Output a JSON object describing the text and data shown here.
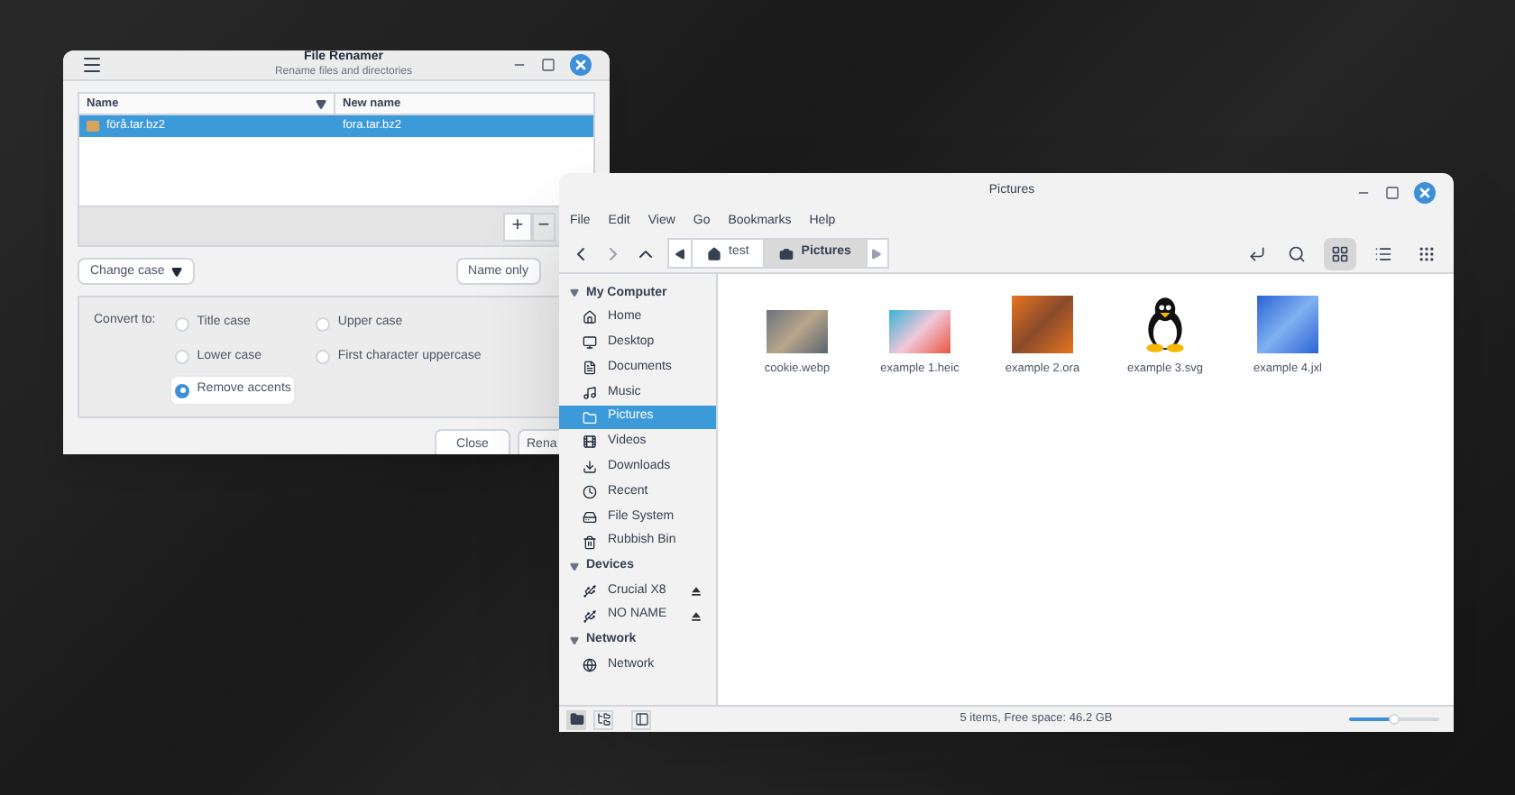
{
  "renamer": {
    "title": "File Renamer",
    "subtitle": "Rename files and directories",
    "table": {
      "columns": [
        {
          "label": "Name",
          "sorted": true
        },
        {
          "label": "New name",
          "sorted": false
        }
      ],
      "rows": [
        {
          "name": "förå.tar.bz2",
          "new_name": "fora.tar.bz2",
          "selected": true
        }
      ]
    },
    "add_button": "+",
    "remove_button": "−",
    "mode_dropdown": "Change case",
    "scope_dropdown": "Name only",
    "convert_label": "Convert to:",
    "options": [
      {
        "label": "Title case",
        "selected": false
      },
      {
        "label": "Upper case",
        "selected": false
      },
      {
        "label": "Lower case",
        "selected": false
      },
      {
        "label": "First character uppercase",
        "selected": false
      },
      {
        "label": "Remove accents",
        "selected": true
      }
    ],
    "buttons": [
      "Close",
      "Rena"
    ]
  },
  "files": {
    "title": "Pictures",
    "menu": [
      "File",
      "Edit",
      "View",
      "Go",
      "Bookmarks",
      "Help"
    ],
    "breadcrumbs": [
      {
        "label": "test",
        "selected": false
      },
      {
        "label": "Pictures",
        "selected": true
      }
    ],
    "views": [
      {
        "selected": true
      },
      {
        "selected": false
      },
      {
        "selected": false
      }
    ],
    "sidebar": [
      {
        "label": "My Computer",
        "expanded": true,
        "items": [
          {
            "label": "Home",
            "selected": false
          },
          {
            "label": "Desktop",
            "selected": false
          },
          {
            "label": "Documents",
            "selected": false
          },
          {
            "label": "Music",
            "selected": false
          },
          {
            "label": "Pictures",
            "selected": true
          },
          {
            "label": "Videos",
            "selected": false
          },
          {
            "label": "Downloads",
            "selected": false
          },
          {
            "label": "Recent",
            "selected": false
          },
          {
            "label": "File System",
            "selected": false
          },
          {
            "label": "Rubbish Bin",
            "selected": false
          }
        ]
      },
      {
        "label": "Devices",
        "expanded": true,
        "items": [
          {
            "label": "Crucial X8",
            "selected": false,
            "ejectable": true
          },
          {
            "label": "NO NAME",
            "selected": false,
            "ejectable": true
          }
        ]
      },
      {
        "label": "Network",
        "expanded": true,
        "items": [
          {
            "label": "Network",
            "selected": false
          }
        ]
      }
    ],
    "items": [
      {
        "name": "cookie.webp"
      },
      {
        "name": "example 1.heic"
      },
      {
        "name": "example 2.ora"
      },
      {
        "name": "example 3.svg"
      },
      {
        "name": "example 4.jxl"
      }
    ],
    "status": "5 items, Free space: 46.2 GB",
    "zoom": {
      "level": 0.5
    }
  }
}
